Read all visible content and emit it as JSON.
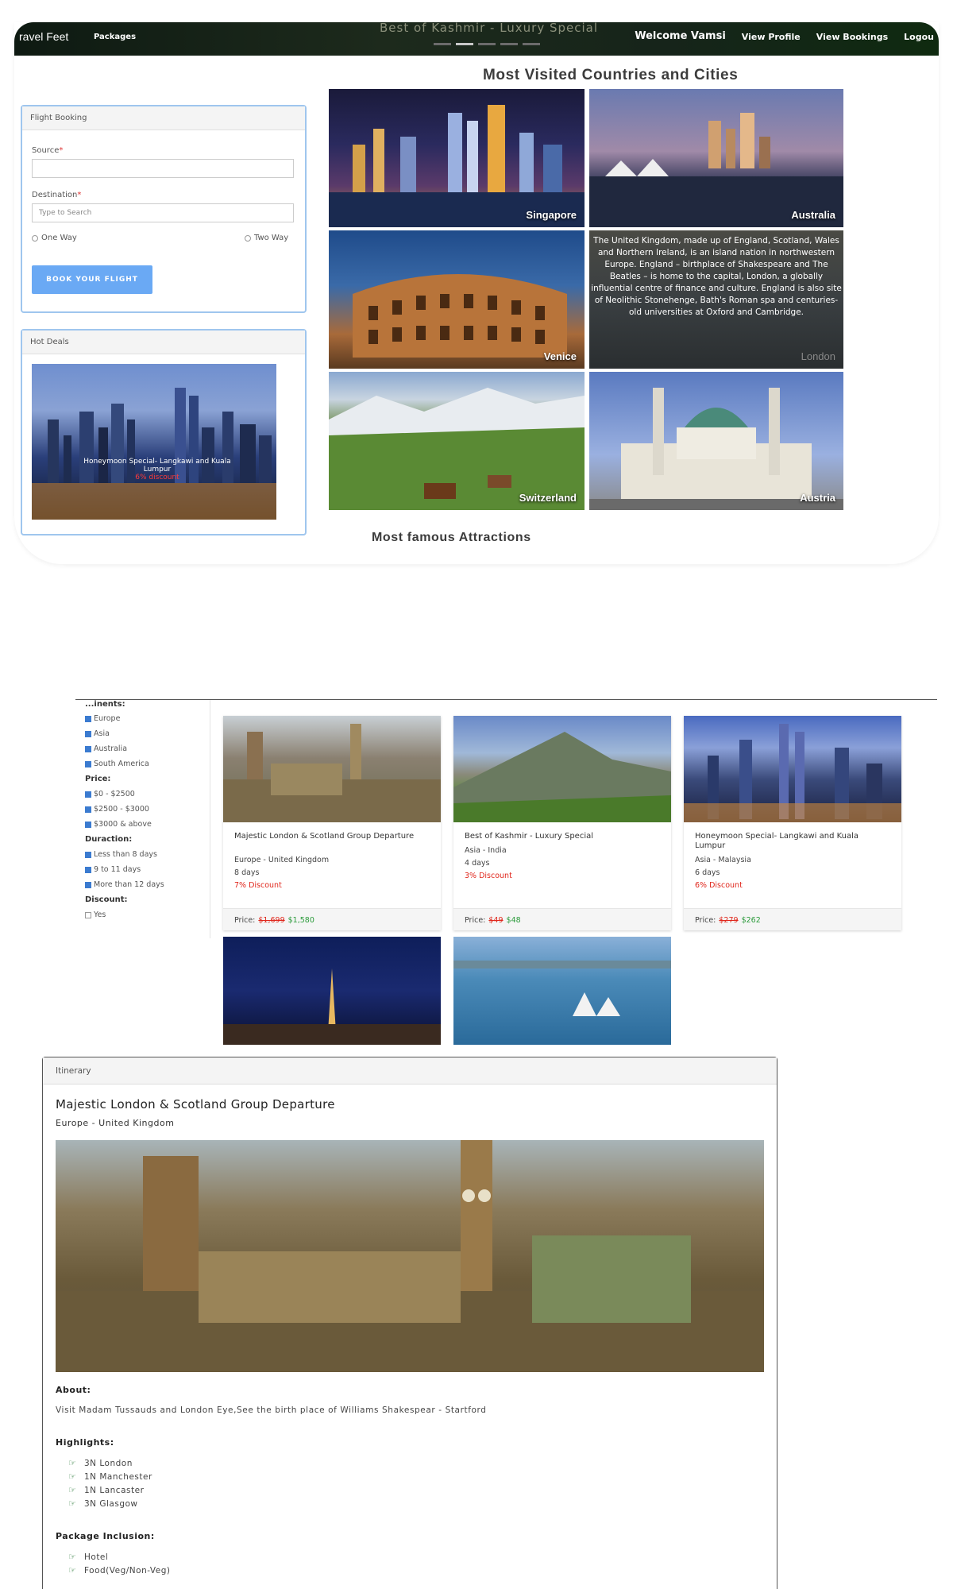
{
  "navbar": {
    "brand": "ravel Feet",
    "packages": "Packages",
    "carousel_caption": "Best of Kashmir - Luxury Special",
    "welcome": "Welcome Vamsi",
    "view_profile": "View Profile",
    "view_bookings": "View Bookings",
    "logout": "Logou"
  },
  "visited": {
    "title": "Most Visited Countries and Cities",
    "tiles": [
      {
        "caption": "Singapore"
      },
      {
        "caption": "Australia"
      },
      {
        "caption": "Venice"
      },
      {
        "caption": "London",
        "description": "The United Kingdom, made up of England, Scotland, Wales and Northern Ireland, is an island nation in northwestern Europe. England – birthplace of Shakespeare and The Beatles – is home to the capital, London, a globally influential centre of finance and culture. England is also site of Neolithic Stonehenge, Bath's Roman spa and centuries-old universities at Oxford and Cambridge."
      },
      {
        "caption": "Switzerland"
      },
      {
        "caption": "Austria"
      }
    ]
  },
  "attractions_title": "Most famous Attractions",
  "flight_booking": {
    "heading": "Flight Booking",
    "source_label": "Source",
    "destination_label": "Destination",
    "destination_placeholder": "Type to Search",
    "one_way": "One Way",
    "two_way": "Two Way",
    "book_button": "BOOK YOUR FLIGHT"
  },
  "hot_deals": {
    "heading": "Hot Deals",
    "deal_title": "Honeymoon Special- Langkawi and Kuala Lumpur",
    "deal_discount": "6% discount"
  },
  "filters": {
    "continents_head": "...inents:",
    "continents": [
      "Europe",
      "Asia",
      "Australia",
      "South America"
    ],
    "price_head": "Price:",
    "prices": [
      "$0 - $2500",
      "$2500 - $3000",
      "$3000 & above"
    ],
    "duration_head": "Duraction:",
    "durations": [
      "Less than 8 days",
      "9 to 11 days",
      "More than 12 days"
    ],
    "discount_head": "Discount:",
    "discount_yes": "Yes"
  },
  "packages": [
    {
      "title": "Majestic London & Scotland Group Departure",
      "location": "Europe - United Kingdom",
      "days": "8 days",
      "discount": "7% Discount",
      "price_label": "Price:",
      "old_price": "$1,699",
      "new_price": "$1,580"
    },
    {
      "title": "Best of Kashmir - Luxury Special",
      "location": "Asia - India",
      "days": "4 days",
      "discount": "3% Discount",
      "price_label": "Price:",
      "old_price": "$49",
      "new_price": "$48"
    },
    {
      "title": "Honeymoon Special- Langkawi and Kuala Lumpur",
      "location": "Asia - Malaysia",
      "days": "6 days",
      "discount": "6% Discount",
      "price_label": "Price:",
      "old_price": "$279",
      "new_price": "$262"
    }
  ],
  "itinerary": {
    "heading": "Itinerary",
    "title": "Majestic London & Scotland Group Departure",
    "subtitle": "Europe - United Kingdom",
    "about_head": "About:",
    "about_text": "Visit Madam Tussauds and London Eye,See the birth place of Williams Shakespear - Startford",
    "highlights_head": "Highlights:",
    "highlights": [
      "3N London",
      "1N Manchester",
      "1N Lancaster",
      "3N Glasgow"
    ],
    "inclusion_head": "Package Inclusion:",
    "inclusions": [
      "Hotel",
      "Food(Veg/Non-Veg)"
    ]
  },
  "colors": {
    "accent": "#6aa9f4",
    "discount": "#e0261b",
    "price_new": "#2a9a3a"
  }
}
